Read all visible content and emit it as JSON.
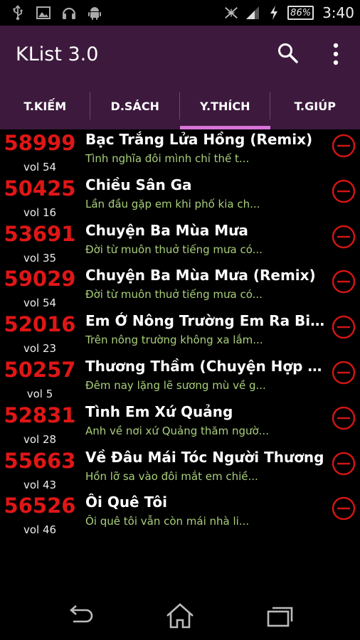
{
  "status_bar": {
    "icons": [
      "usb-icon",
      "image-icon",
      "headset-icon",
      "android-icon"
    ],
    "right_icons": [
      "no-signal-icon",
      "cell-signal-icon",
      "charging-icon"
    ],
    "battery": "86%",
    "time": "3:40"
  },
  "action_bar": {
    "title": "KList 3.0",
    "search_icon": "search-icon",
    "menu_icon": "overflow-menu-icon"
  },
  "tabs": [
    {
      "label": "T.KIẾM",
      "active": false
    },
    {
      "label": "D.SÁCH",
      "active": false
    },
    {
      "label": "Y.THÍCH",
      "active": true
    },
    {
      "label": "T.GIÚP",
      "active": false
    }
  ],
  "songs": [
    {
      "code": "58999",
      "vol": "vol 54",
      "title": "Bạc Trắng Lửa Hồng (Remix)",
      "lyric": "Tình nghĩa đôi mình chỉ thế t..."
    },
    {
      "code": "50425",
      "vol": "vol 16",
      "title": "Chiều Sân Ga",
      "lyric": "Lần đầu gặp em khi phố kia ch..."
    },
    {
      "code": "53691",
      "vol": "vol 35",
      "title": "Chuyện Ba Mùa Mưa",
      "lyric": "Đời từ muôn thuở tiếng mưa có..."
    },
    {
      "code": "59029",
      "vol": "vol 54",
      "title": "Chuyện Ba Mùa Mưa (Remix)",
      "lyric": "Đời từ muôn thuở tiếng mưa có..."
    },
    {
      "code": "52016",
      "vol": "vol 23",
      "title": "Em Ở Nông Trường Em Ra Biên ...",
      "lyric": "Trên nông trường không xa lắm..."
    },
    {
      "code": "50257",
      "vol": "vol 5",
      "title": "Thương Thầm (Chuyện Hợp Tan)",
      "lyric": "Đêm nay lặng lẽ sương mù về g..."
    },
    {
      "code": "52831",
      "vol": "vol 28",
      "title": "Tình Em Xứ Quảng",
      "lyric": "Anh về nơi xứ Quảng thăm ngườ..."
    },
    {
      "code": "55663",
      "vol": "vol 43",
      "title": "Về Đâu Mái Tóc Người Thương",
      "lyric": "Hồn lỡ sa vào đôi mắt em chiề..."
    },
    {
      "code": "56526",
      "vol": "vol 46",
      "title": "Ôi Quê Tôi",
      "lyric": "Ôi quê tôi vẫn còn mái nhà li..."
    }
  ],
  "nav_bar": {
    "buttons": [
      "back-icon",
      "home-icon",
      "recent-apps-icon"
    ]
  },
  "colors": {
    "accent": "#3d1a3d",
    "tab_indicator": "#d873d8",
    "code": "#e01616",
    "lyric": "#a9cf7a",
    "remove": "#d01515"
  }
}
